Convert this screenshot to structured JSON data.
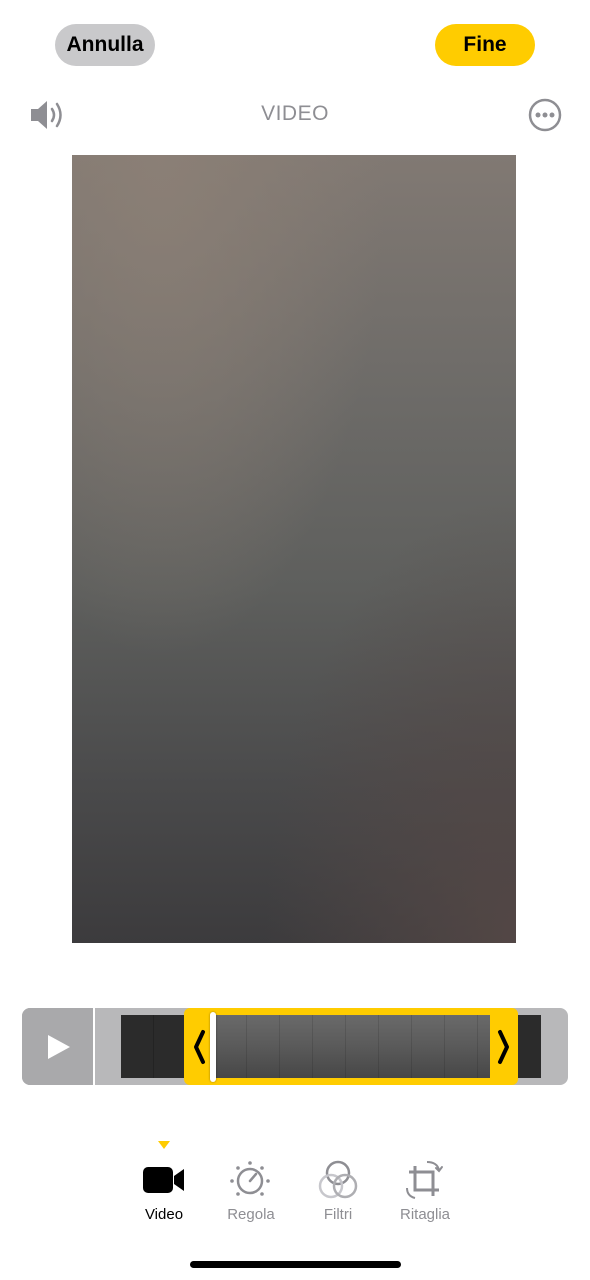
{
  "header": {
    "cancel_label": "Annulla",
    "done_label": "Fine",
    "title": "VIDEO"
  },
  "icons": {
    "audio": "speaker-icon",
    "more": "ellipsis-circle-icon",
    "play": "play-icon",
    "trim_left": "chevron-left-icon",
    "trim_right": "chevron-right-icon",
    "video_tab": "video-camera-icon",
    "adjust_tab": "dial-icon",
    "filters_tab": "overlapping-circles-icon",
    "crop_tab": "crop-rotate-icon"
  },
  "colors": {
    "accent": "#ffcc00",
    "secondary_text": "#8e8e93"
  },
  "tabs": [
    {
      "label": "Video",
      "active": true
    },
    {
      "label": "Regola",
      "active": false
    },
    {
      "label": "Filtri",
      "active": false
    },
    {
      "label": "Ritaglia",
      "active": false
    }
  ]
}
